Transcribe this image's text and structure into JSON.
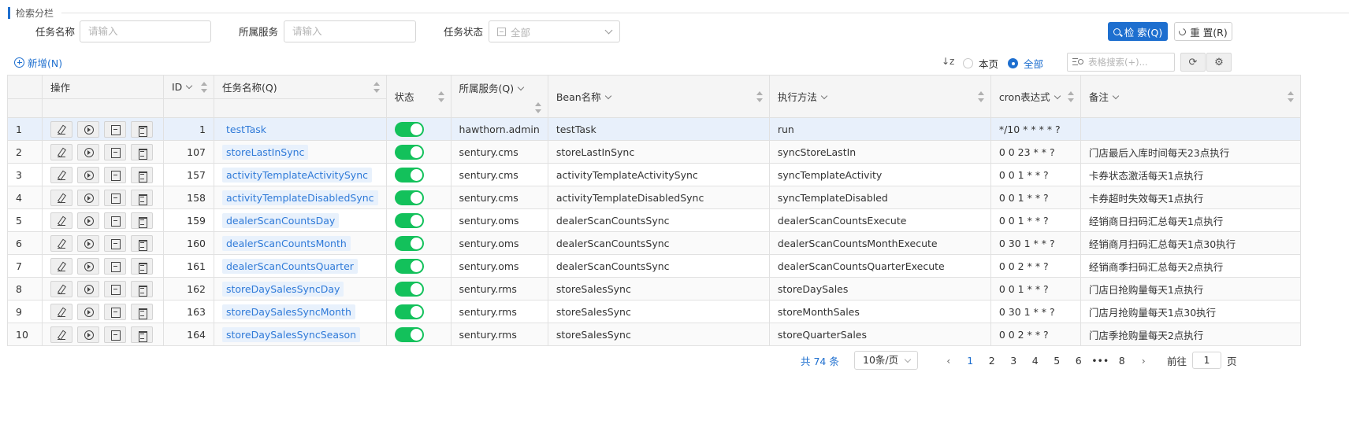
{
  "search": {
    "section_title": "检索分栏",
    "task_name_label": "任务名称",
    "task_name_placeholder": "请输入",
    "service_label": "所属服务",
    "service_placeholder": "请输入",
    "status_label": "任务状态",
    "status_placeholder": "全部",
    "search_button": "检 索(Q)",
    "reset_button": "重 置(R)"
  },
  "toolbar": {
    "add_button": "新增(N)",
    "sort_icon": "↓z",
    "radio_page": "本页",
    "radio_all": "全部",
    "radio_selected": "all",
    "table_search_placeholder": "表格搜索(+)...",
    "refresh_icon": "⟳",
    "settings_icon": "⚙"
  },
  "table": {
    "columns": {
      "op": "操作",
      "id": "ID",
      "name": "任务名称(Q)",
      "status": "状态",
      "service": "所属服务(Q)",
      "bean": "Bean名称",
      "method": "执行方法",
      "cron": "cron表达式",
      "remark": "备注"
    },
    "rows": [
      {
        "idx": "1",
        "id": "1",
        "name": "testTask",
        "service": "hawthorn.admin",
        "bean": "testTask",
        "method": "run",
        "cron": "*/10 * * * * ?",
        "remark": ""
      },
      {
        "idx": "2",
        "id": "107",
        "name": "storeLastInSync",
        "service": "sentury.cms",
        "bean": "storeLastInSync",
        "method": "syncStoreLastIn",
        "cron": "0 0 23 * * ?",
        "remark": "门店最后入库时间每天23点执行"
      },
      {
        "idx": "3",
        "id": "157",
        "name": "activityTemplateActivitySync",
        "service": "sentury.cms",
        "bean": "activityTemplateActivitySync",
        "method": "syncTemplateActivity",
        "cron": "0 0 1 * * ?",
        "remark": "卡券状态激活每天1点执行"
      },
      {
        "idx": "4",
        "id": "158",
        "name": "activityTemplateDisabledSync",
        "service": "sentury.cms",
        "bean": "activityTemplateDisabledSync",
        "method": "syncTemplateDisabled",
        "cron": "0 0 1 * * ?",
        "remark": "卡券超时失效每天1点执行"
      },
      {
        "idx": "5",
        "id": "159",
        "name": "dealerScanCountsDay",
        "service": "sentury.oms",
        "bean": "dealerScanCountsSync",
        "method": "dealerScanCountsExecute",
        "cron": "0 0 1 * * ?",
        "remark": "经销商日扫码汇总每天1点执行"
      },
      {
        "idx": "6",
        "id": "160",
        "name": "dealerScanCountsMonth",
        "service": "sentury.oms",
        "bean": "dealerScanCountsSync",
        "method": "dealerScanCountsMonthExecute",
        "cron": "0 30 1 * * ?",
        "remark": "经销商月扫码汇总每天1点30执行"
      },
      {
        "idx": "7",
        "id": "161",
        "name": "dealerScanCountsQuarter",
        "service": "sentury.oms",
        "bean": "dealerScanCountsSync",
        "method": "dealerScanCountsQuarterExecute",
        "cron": "0 0 2 * * ?",
        "remark": "经销商季扫码汇总每天2点执行"
      },
      {
        "idx": "8",
        "id": "162",
        "name": "storeDaySalesSyncDay",
        "service": "sentury.rms",
        "bean": "storeSalesSync",
        "method": "storeDaySales",
        "cron": "0 0 1 * * ?",
        "remark": "门店日抢购量每天1点执行"
      },
      {
        "idx": "9",
        "id": "163",
        "name": "storeDaySalesSyncMonth",
        "service": "sentury.rms",
        "bean": "storeSalesSync",
        "method": "storeMonthSales",
        "cron": "0 30 1 * * ?",
        "remark": "门店月抢购量每天1点30执行"
      },
      {
        "idx": "10",
        "id": "164",
        "name": "storeDaySalesSyncSeason",
        "service": "sentury.rms",
        "bean": "storeSalesSync",
        "method": "storeQuarterSales",
        "cron": "0 0 2 * * ?",
        "remark": "门店季抢购量每天2点执行"
      }
    ]
  },
  "pagination": {
    "total": "共 74 条",
    "page_size": "10条/页",
    "prev": "‹",
    "pages": [
      "1",
      "2",
      "3",
      "4",
      "5",
      "6",
      "•••",
      "8"
    ],
    "current": "1",
    "next": "›",
    "goto_label": "前往",
    "goto_value": "1",
    "goto_suffix": "页"
  },
  "colors": {
    "primary": "#1e6fcf",
    "switch_on": "#13c15b",
    "tag_bg": "#e8f1fc",
    "selected_row": "#e8f0fb"
  }
}
